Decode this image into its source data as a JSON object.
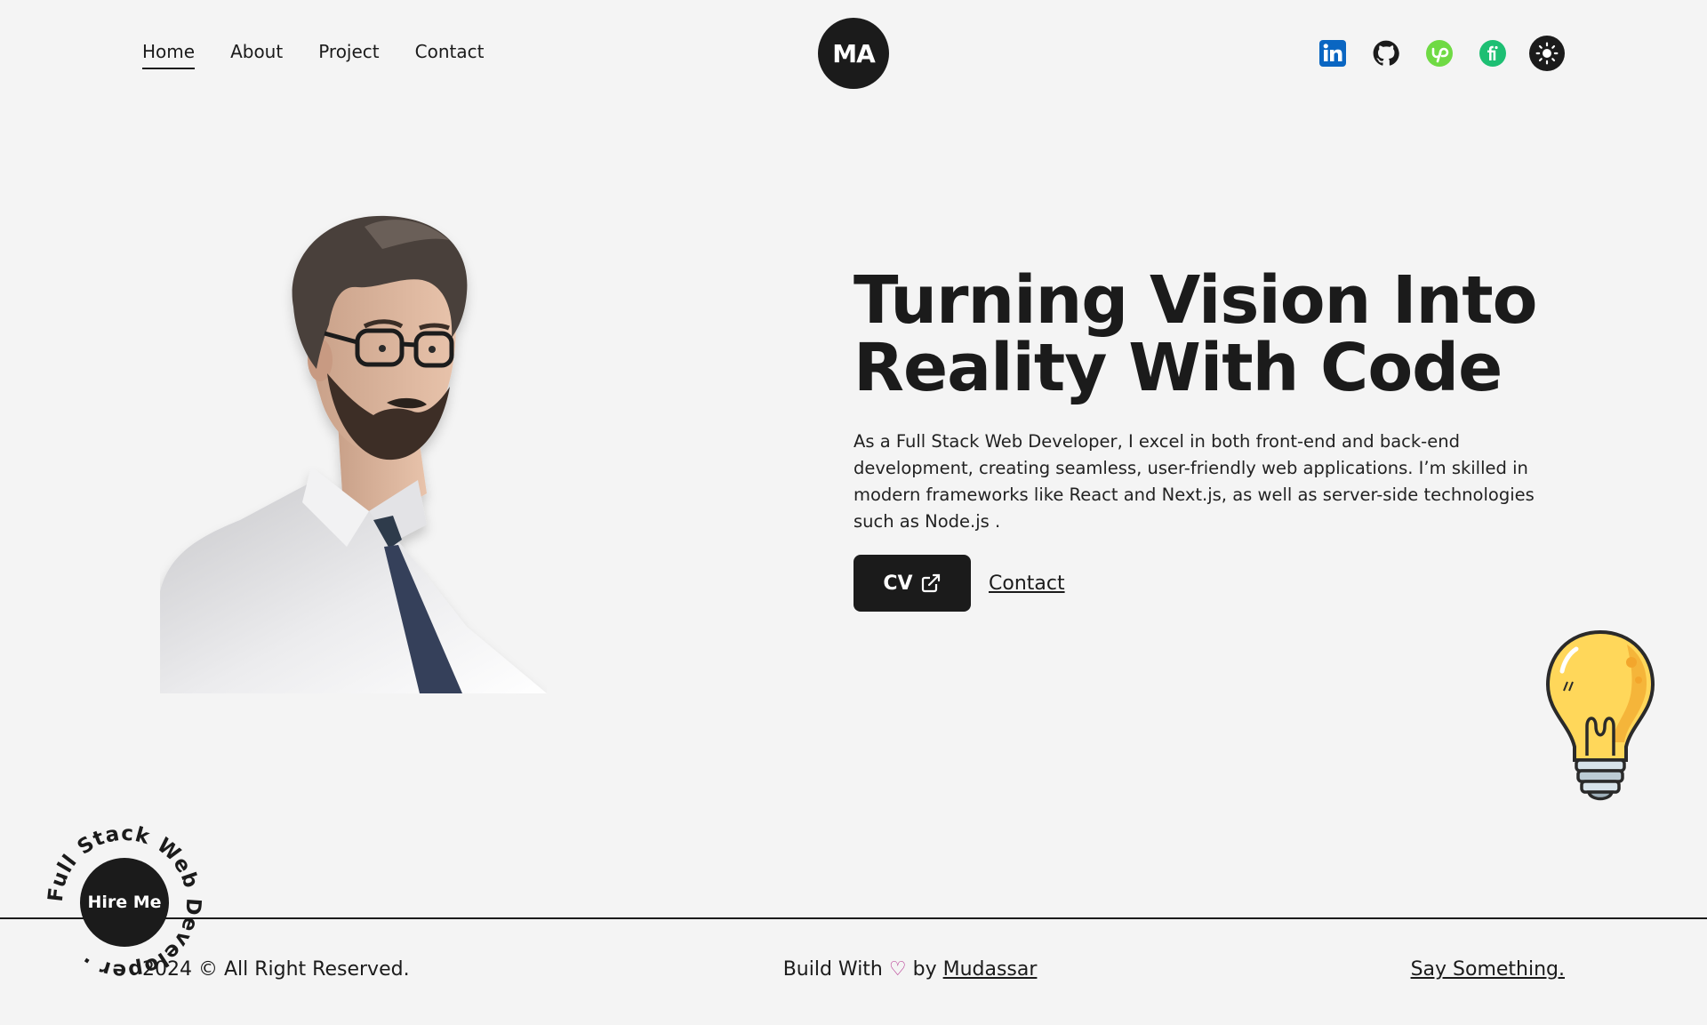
{
  "nav": {
    "items": [
      {
        "label": "Home",
        "active": true
      },
      {
        "label": "About"
      },
      {
        "label": "Project"
      },
      {
        "label": "Contact"
      }
    ]
  },
  "logo": {
    "text": "MA"
  },
  "socials": [
    {
      "icon": "linkedin-icon",
      "color": "#0a66c2"
    },
    {
      "icon": "github-icon",
      "color": "#1b1b1b"
    },
    {
      "icon": "upwork-icon",
      "color": "#6fda44"
    },
    {
      "icon": "fiverr-icon",
      "color": "#1dbf73"
    },
    {
      "icon": "sun-icon",
      "color": "#1b1b1b"
    }
  ],
  "hero": {
    "title_line1": "Turning Vision Into",
    "title_line2": "Reality With Code",
    "description": "As a Full Stack Web Developer, I excel in both front-end and back-end development, creating seamless, user-friendly web applications. I’m skilled in modern frameworks like React and Next.js, as well as server-side technologies such as Node.js .",
    "cv_label": "CV",
    "contact_label": "Contact"
  },
  "hire": {
    "button_label": "Hire Me",
    "ring_text": "Full Stack Web Developer · "
  },
  "footer": {
    "copyright": "2024 © All Right Reserved.",
    "build_prefix": "Build With",
    "heart": "♡",
    "build_by": "by",
    "author": "Mudassar",
    "say_something": "Say Something."
  },
  "colors": {
    "background": "#f4f4f4",
    "dark": "#1b1b1b",
    "heart": "#b5338f"
  }
}
